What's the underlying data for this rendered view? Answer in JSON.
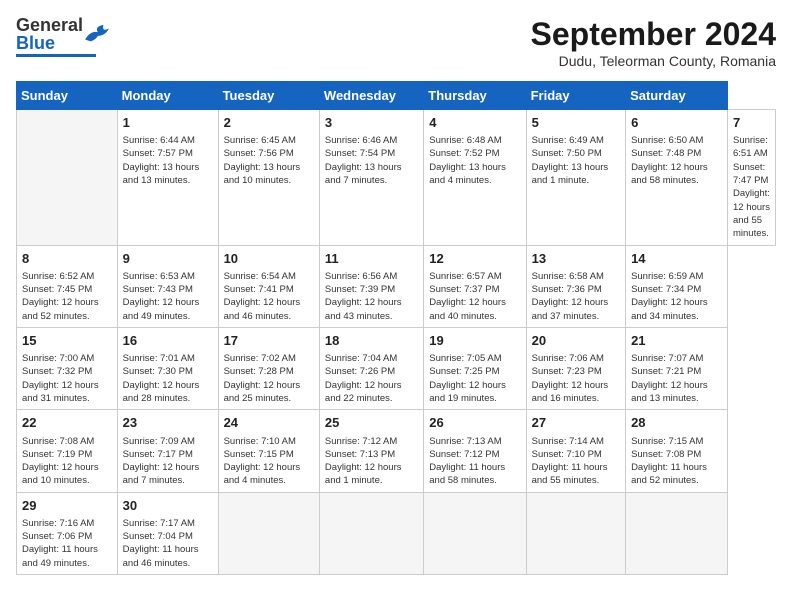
{
  "app": {
    "logo_general": "General",
    "logo_blue": "Blue",
    "title": "September 2024",
    "subtitle": "Dudu, Teleorman County, Romania"
  },
  "calendar": {
    "headers": [
      "Sunday",
      "Monday",
      "Tuesday",
      "Wednesday",
      "Thursday",
      "Friday",
      "Saturday"
    ],
    "weeks": [
      [
        {
          "num": "",
          "info": "",
          "empty": true
        },
        {
          "num": "1",
          "info": "Sunrise: 6:44 AM\nSunset: 7:57 PM\nDaylight: 13 hours\nand 13 minutes."
        },
        {
          "num": "2",
          "info": "Sunrise: 6:45 AM\nSunset: 7:56 PM\nDaylight: 13 hours\nand 10 minutes."
        },
        {
          "num": "3",
          "info": "Sunrise: 6:46 AM\nSunset: 7:54 PM\nDaylight: 13 hours\nand 7 minutes."
        },
        {
          "num": "4",
          "info": "Sunrise: 6:48 AM\nSunset: 7:52 PM\nDaylight: 13 hours\nand 4 minutes."
        },
        {
          "num": "5",
          "info": "Sunrise: 6:49 AM\nSunset: 7:50 PM\nDaylight: 13 hours\nand 1 minute."
        },
        {
          "num": "6",
          "info": "Sunrise: 6:50 AM\nSunset: 7:48 PM\nDaylight: 12 hours\nand 58 minutes."
        },
        {
          "num": "7",
          "info": "Sunrise: 6:51 AM\nSunset: 7:47 PM\nDaylight: 12 hours\nand 55 minutes."
        }
      ],
      [
        {
          "num": "8",
          "info": "Sunrise: 6:52 AM\nSunset: 7:45 PM\nDaylight: 12 hours\nand 52 minutes."
        },
        {
          "num": "9",
          "info": "Sunrise: 6:53 AM\nSunset: 7:43 PM\nDaylight: 12 hours\nand 49 minutes."
        },
        {
          "num": "10",
          "info": "Sunrise: 6:54 AM\nSunset: 7:41 PM\nDaylight: 12 hours\nand 46 minutes."
        },
        {
          "num": "11",
          "info": "Sunrise: 6:56 AM\nSunset: 7:39 PM\nDaylight: 12 hours\nand 43 minutes."
        },
        {
          "num": "12",
          "info": "Sunrise: 6:57 AM\nSunset: 7:37 PM\nDaylight: 12 hours\nand 40 minutes."
        },
        {
          "num": "13",
          "info": "Sunrise: 6:58 AM\nSunset: 7:36 PM\nDaylight: 12 hours\nand 37 minutes."
        },
        {
          "num": "14",
          "info": "Sunrise: 6:59 AM\nSunset: 7:34 PM\nDaylight: 12 hours\nand 34 minutes."
        }
      ],
      [
        {
          "num": "15",
          "info": "Sunrise: 7:00 AM\nSunset: 7:32 PM\nDaylight: 12 hours\nand 31 minutes."
        },
        {
          "num": "16",
          "info": "Sunrise: 7:01 AM\nSunset: 7:30 PM\nDaylight: 12 hours\nand 28 minutes."
        },
        {
          "num": "17",
          "info": "Sunrise: 7:02 AM\nSunset: 7:28 PM\nDaylight: 12 hours\nand 25 minutes."
        },
        {
          "num": "18",
          "info": "Sunrise: 7:04 AM\nSunset: 7:26 PM\nDaylight: 12 hours\nand 22 minutes."
        },
        {
          "num": "19",
          "info": "Sunrise: 7:05 AM\nSunset: 7:25 PM\nDaylight: 12 hours\nand 19 minutes."
        },
        {
          "num": "20",
          "info": "Sunrise: 7:06 AM\nSunset: 7:23 PM\nDaylight: 12 hours\nand 16 minutes."
        },
        {
          "num": "21",
          "info": "Sunrise: 7:07 AM\nSunset: 7:21 PM\nDaylight: 12 hours\nand 13 minutes."
        }
      ],
      [
        {
          "num": "22",
          "info": "Sunrise: 7:08 AM\nSunset: 7:19 PM\nDaylight: 12 hours\nand 10 minutes."
        },
        {
          "num": "23",
          "info": "Sunrise: 7:09 AM\nSunset: 7:17 PM\nDaylight: 12 hours\nand 7 minutes."
        },
        {
          "num": "24",
          "info": "Sunrise: 7:10 AM\nSunset: 7:15 PM\nDaylight: 12 hours\nand 4 minutes."
        },
        {
          "num": "25",
          "info": "Sunrise: 7:12 AM\nSunset: 7:13 PM\nDaylight: 12 hours\nand 1 minute."
        },
        {
          "num": "26",
          "info": "Sunrise: 7:13 AM\nSunset: 7:12 PM\nDaylight: 11 hours\nand 58 minutes."
        },
        {
          "num": "27",
          "info": "Sunrise: 7:14 AM\nSunset: 7:10 PM\nDaylight: 11 hours\nand 55 minutes."
        },
        {
          "num": "28",
          "info": "Sunrise: 7:15 AM\nSunset: 7:08 PM\nDaylight: 11 hours\nand 52 minutes."
        }
      ],
      [
        {
          "num": "29",
          "info": "Sunrise: 7:16 AM\nSunset: 7:06 PM\nDaylight: 11 hours\nand 49 minutes."
        },
        {
          "num": "30",
          "info": "Sunrise: 7:17 AM\nSunset: 7:04 PM\nDaylight: 11 hours\nand 46 minutes."
        },
        {
          "num": "",
          "info": "",
          "empty": true
        },
        {
          "num": "",
          "info": "",
          "empty": true
        },
        {
          "num": "",
          "info": "",
          "empty": true
        },
        {
          "num": "",
          "info": "",
          "empty": true
        },
        {
          "num": "",
          "info": "",
          "empty": true
        }
      ]
    ]
  }
}
